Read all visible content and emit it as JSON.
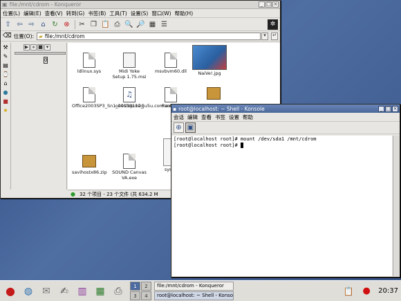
{
  "konqueror": {
    "title": "file:/mnt/cdrom - Konqueror",
    "menu": [
      "位置(L)",
      "编辑(E)",
      "查看(V)",
      "转到(G)",
      "书签(B)",
      "工具(T)",
      "设置(S)",
      "窗口(W)",
      "帮助(H)"
    ],
    "location_label": "位置(O):",
    "location_value": "file:/mnt/cdrom",
    "panel_value": "0",
    "files": [
      {
        "name": "ldlinux.sys"
      },
      {
        "name": "Midi Yoke Setup 1.75.msi"
      },
      {
        "name": "msvbvm60.dll"
      },
      {
        "name": "NaiVe!.jpg"
      },
      {
        "name": "Office2003SP3_Sn1_20130112_ju5u.com.exe"
      },
      {
        "name": "onestop.mid"
      },
      {
        "name": "PanDow"
      },
      {
        "name": "savihostx86.zip"
      },
      {
        "name": "SOUND Canvas VA.exe"
      },
      {
        "name": "syslin"
      }
    ],
    "status": "32 个项目 - 23 个文件 (共 634.2 M"
  },
  "konsole": {
    "title": "root@localhost: ~ Shell - Konsole",
    "menu": [
      "会话",
      "编辑",
      "查看",
      "书签",
      "设置",
      "帮助"
    ],
    "lines": [
      "[root@localhost root]# mount /dev/sda1 /mnt/cdrom",
      "[root@localhost root]# "
    ]
  },
  "taskbar": {
    "pager": [
      "1",
      "2",
      "3",
      "4"
    ],
    "tasks": [
      "file:/mnt/cdrom - Konqueror",
      "root@localhost: ~ Shell - Konsole"
    ],
    "clock": "20:37"
  },
  "colors": {
    "desktop": "#3f5a8c",
    "active_title": "#4b6899"
  }
}
